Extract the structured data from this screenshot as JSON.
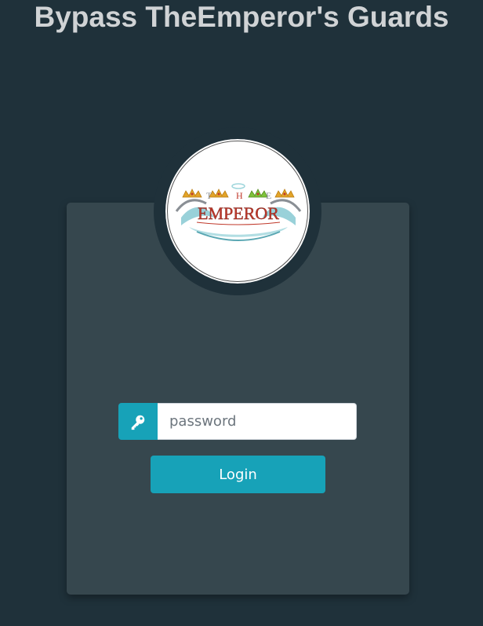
{
  "page": {
    "title": "Bypass TheEmperor's Guards"
  },
  "logo": {
    "alt": "The Emperor logo",
    "text_top": "T H E",
    "text_main": "EMPEROR"
  },
  "form": {
    "password_placeholder": "password",
    "password_value": "",
    "key_icon": "key-icon",
    "login_label": "Login"
  },
  "colors": {
    "background": "#1f313a",
    "card": "#36474e",
    "accent": "#17a2b8",
    "title": "#d0d3d5"
  }
}
